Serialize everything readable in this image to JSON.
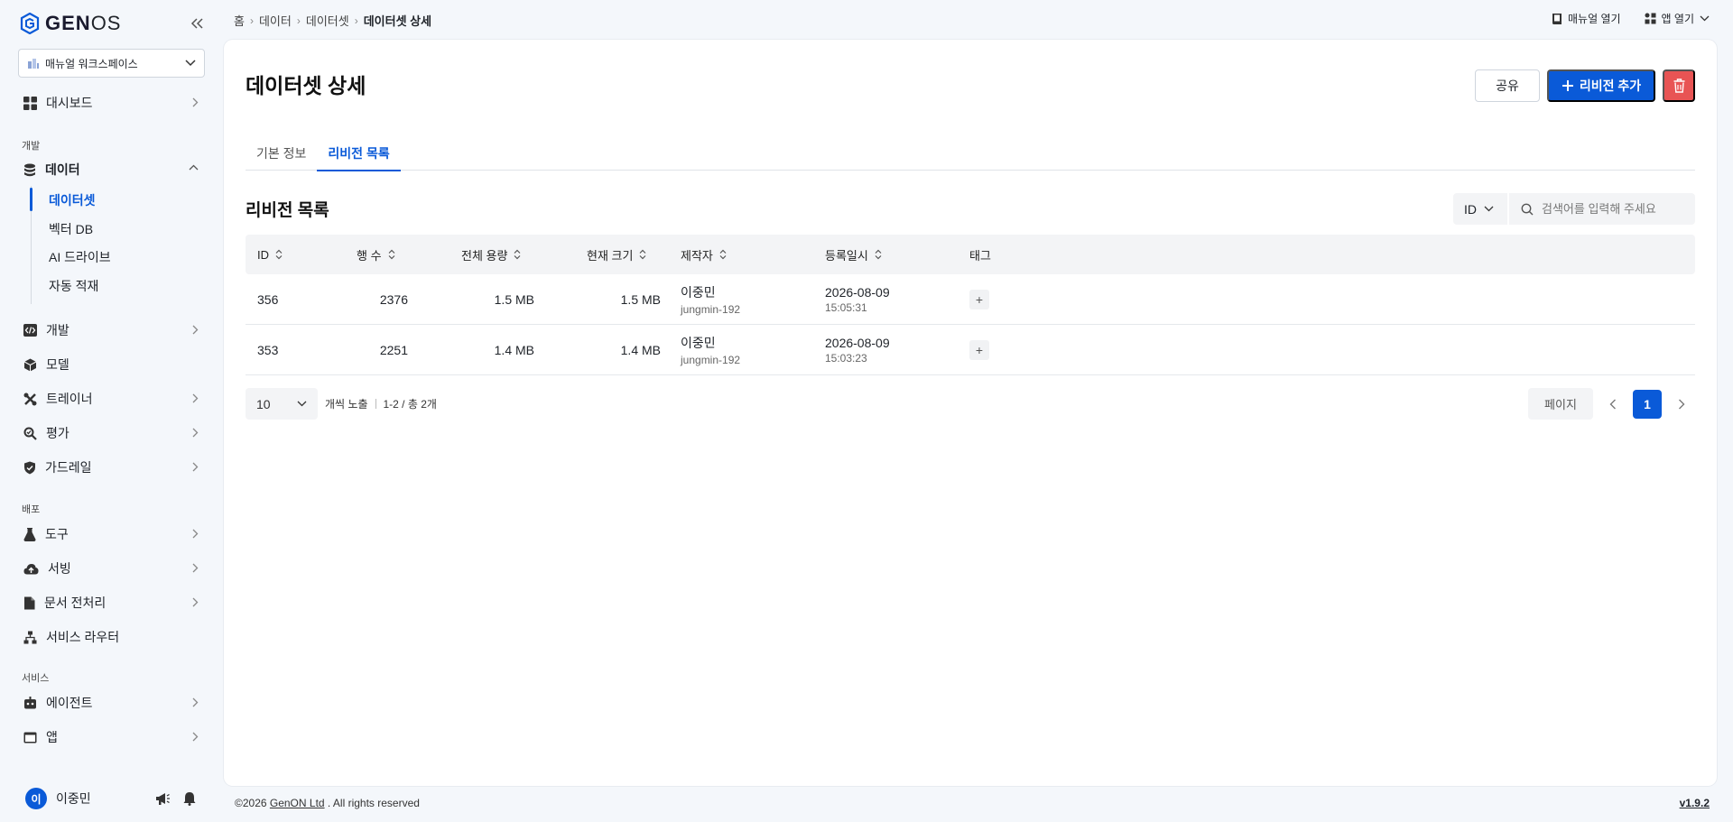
{
  "app": {
    "logo_prefix": "GEN",
    "logo_suffix": "OS",
    "workspace": "매뉴얼 워크스페이스"
  },
  "sidebar": {
    "dashboard": "대시보드",
    "section_dev": "개발",
    "data": "데이터",
    "data_sub": [
      "데이터셋",
      "벡터 DB",
      "AI 드라이브",
      "자동 적재"
    ],
    "develop": "개발",
    "model": "모델",
    "trainer": "트레이너",
    "evaluate": "평가",
    "guardrail": "가드레일",
    "section_deploy": "배포",
    "tools": "도구",
    "serving": "서빙",
    "doc_preprocess": "문서 전처리",
    "service_router": "서비스 라우터",
    "section_service": "서비스",
    "agent": "에이전트",
    "app": "앱",
    "user_initial": "이",
    "user_name": "이중민"
  },
  "breadcrumb": [
    "홈",
    "데이터",
    "데이터셋",
    "데이터셋 상세"
  ],
  "top_actions": {
    "manual": "매뉴얼 열기",
    "app_open": "앱 열기"
  },
  "page": {
    "title": "데이터셋 상세",
    "share": "공유",
    "add_revision": "리비전 추가",
    "tabs": [
      "기본 정보",
      "리비전 목록"
    ],
    "section_title": "리비전 목록",
    "filter_value": "ID",
    "search_placeholder": "검색어를 입력해 주세요"
  },
  "table": {
    "headers": [
      "ID",
      "행 수",
      "전체 용량",
      "현재 크기",
      "제작자",
      "등록일시",
      "태그"
    ],
    "rows": [
      {
        "id": "356",
        "rows": "2376",
        "total": "1.5 MB",
        "current": "1.5 MB",
        "author": "이중민",
        "author_id": "jungmin-192",
        "date": "2026-08-09",
        "time": "15:05:31"
      },
      {
        "id": "353",
        "rows": "2251",
        "total": "1.4 MB",
        "current": "1.4 MB",
        "author": "이중민",
        "author_id": "jungmin-192",
        "date": "2026-08-09",
        "time": "15:03:23"
      }
    ]
  },
  "pager": {
    "page_size": "10",
    "per_page_label": "개씩 노출",
    "range": "1-2 / 총 2개",
    "page_label": "페이지",
    "current_page": "1"
  },
  "footer": {
    "copyright_pre": "©2026 ",
    "company": "GenON Ltd",
    "copyright_post": " . All rights reserved",
    "version": "v1.9.2"
  },
  "colors": {
    "primary": "#0a5ad8",
    "danger": "#e85454"
  }
}
